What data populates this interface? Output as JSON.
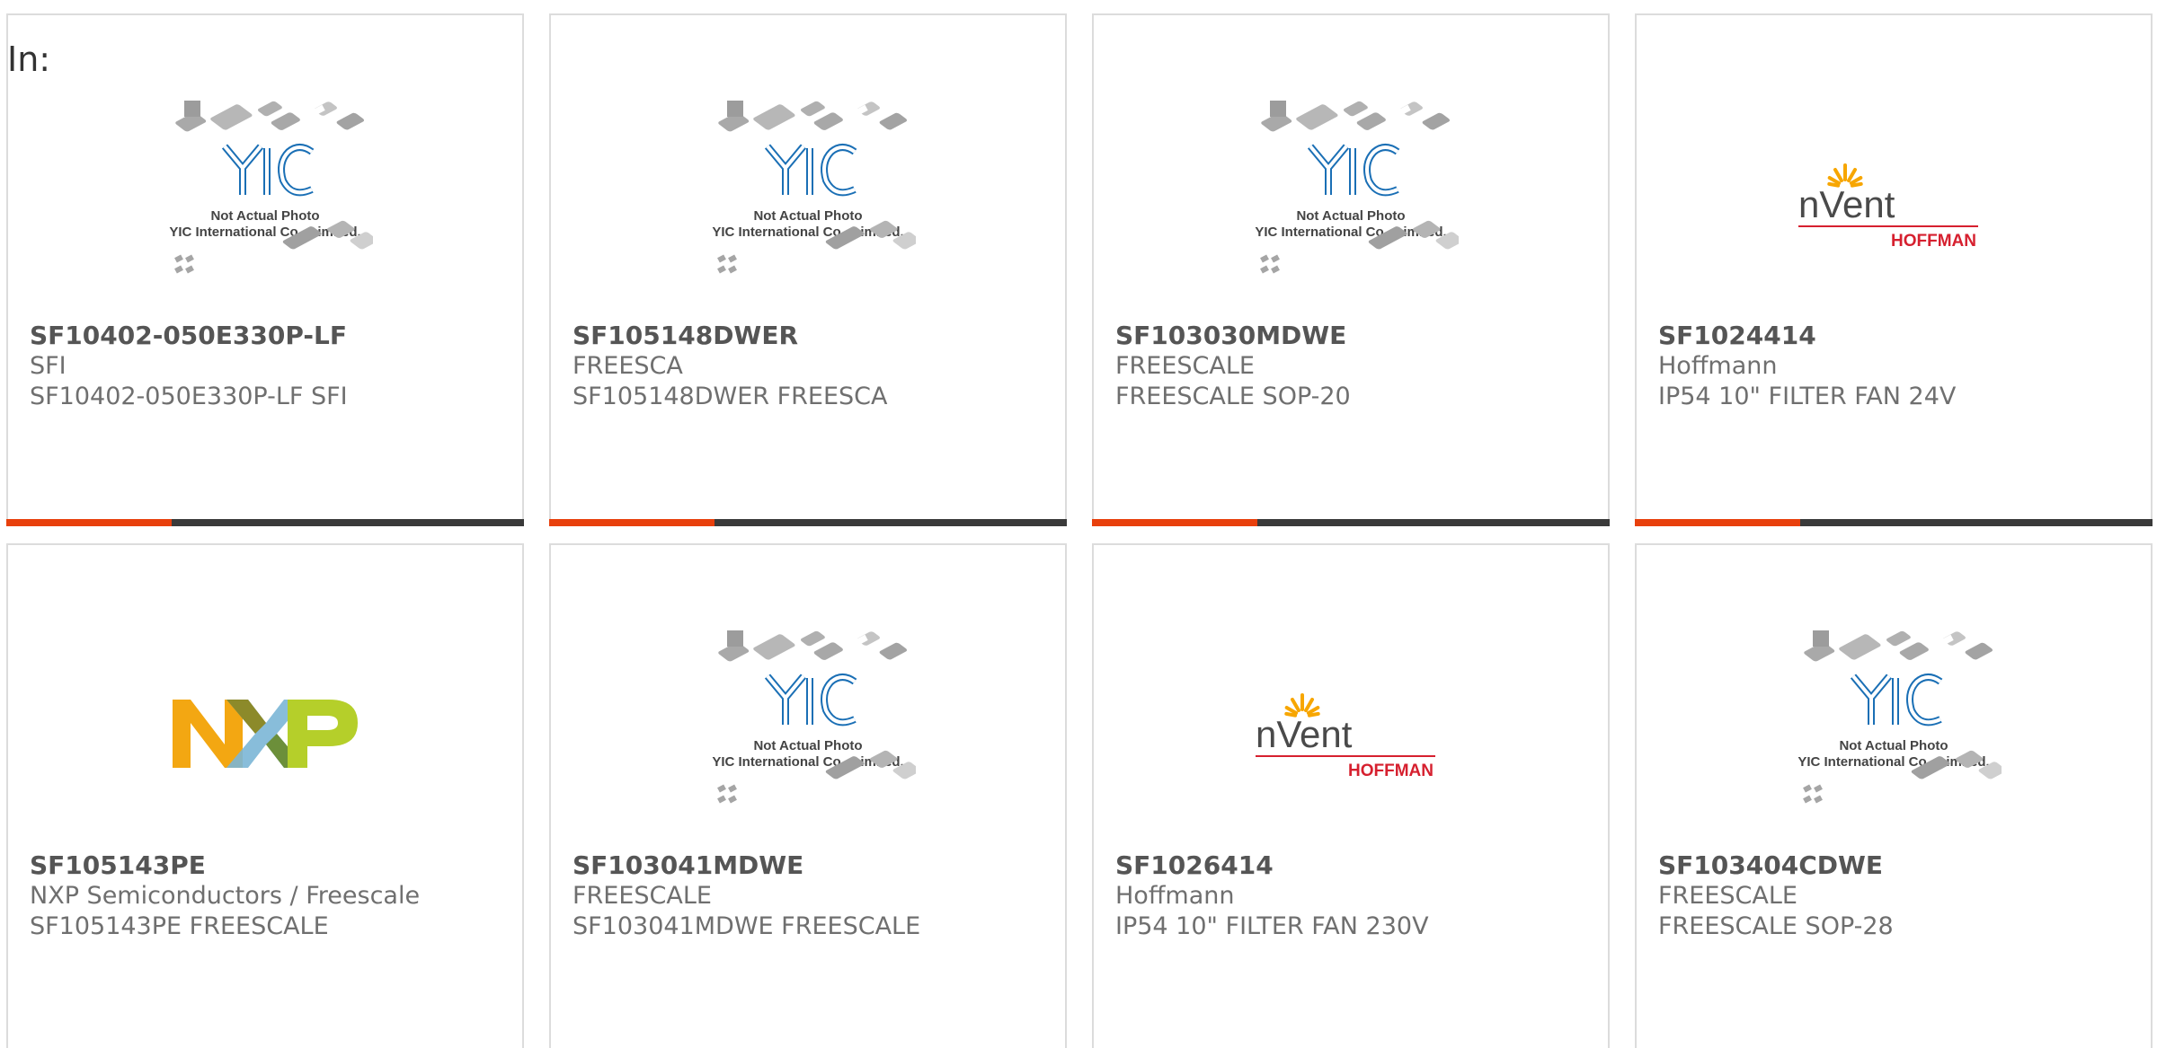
{
  "header": {
    "label": "In:"
  },
  "placeholder_image": {
    "line1": "Not Actual Photo",
    "line2": "YIC International Co., Limited."
  },
  "logos": {
    "nvent": {
      "word": "nVent",
      "sub": "HOFFMAN"
    },
    "nxp": {
      "letters": [
        "N",
        "X",
        "P"
      ]
    }
  },
  "colors": {
    "accent_bar": "#e8400c",
    "bar_dark": "#3a3a3a",
    "yic_blue": "#1a6fb5",
    "hoffman_red": "#d6202f"
  },
  "products": [
    {
      "part_number": "SF10402-050E330P-LF",
      "manufacturer": "SFI",
      "description": "SF10402-050E330P-LF SFI",
      "image": "yic-placeholder"
    },
    {
      "part_number": "SF105148DWER",
      "manufacturer": "FREESCA",
      "description": "SF105148DWER FREESCA",
      "image": "yic-placeholder"
    },
    {
      "part_number": "SF103030MDWE",
      "manufacturer": "FREESCALE",
      "description": "FREESCALE SOP-20",
      "image": "yic-placeholder"
    },
    {
      "part_number": "SF1024414",
      "manufacturer": "Hoffmann",
      "description": "IP54 10\" FILTER FAN 24V",
      "image": "nvent-hoffman-logo"
    },
    {
      "part_number": "SF105143PE",
      "manufacturer": "NXP Semiconductors / Freescale",
      "description": "SF105143PE FREESCALE",
      "image": "nxp-logo"
    },
    {
      "part_number": "SF103041MDWE",
      "manufacturer": "FREESCALE",
      "description": "SF103041MDWE FREESCALE",
      "image": "yic-placeholder"
    },
    {
      "part_number": "SF1026414",
      "manufacturer": "Hoffmann",
      "description": "IP54 10\" FILTER FAN 230V",
      "image": "nvent-hoffman-logo"
    },
    {
      "part_number": "SF103404CDWE",
      "manufacturer": "FREESCALE",
      "description": "FREESCALE SOP-28",
      "image": "yic-placeholder"
    }
  ]
}
